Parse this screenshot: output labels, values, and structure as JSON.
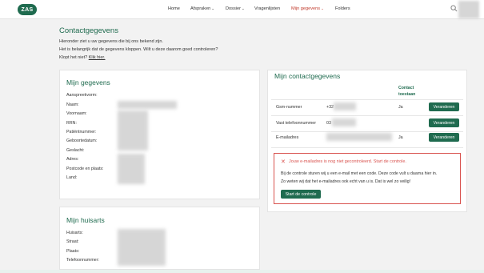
{
  "header": {
    "logo_text": "ZAS",
    "nav": [
      {
        "label": "Home",
        "dropdown": false,
        "active": false
      },
      {
        "label": "Afspraken",
        "dropdown": true,
        "active": false
      },
      {
        "label": "Dossier",
        "dropdown": true,
        "active": false
      },
      {
        "label": "Vragenlijsten",
        "dropdown": false,
        "active": false
      },
      {
        "label": "Mijn gegevens",
        "dropdown": true,
        "active": true
      },
      {
        "label": "Folders",
        "dropdown": false,
        "active": false
      }
    ],
    "chevron": "⌄",
    "icons": {
      "search": "search-icon",
      "avatar": "avatar"
    }
  },
  "page": {
    "title": "Contactgegevens",
    "intro_lines": [
      "Hieronder ziet u uw gegevens die bij ons bekend zijn.",
      "Het is belangrijk dat de gegevens kloppen. Wilt u deze daarom goed controleren?"
    ],
    "intro_question": "Klopt het niet?",
    "intro_link": "Klik hier."
  },
  "mijn_gegevens": {
    "title": "Mijn gegevens",
    "labels": [
      "Aanspreekvorm:",
      "Naam:",
      "Voornaam:",
      "RRN:",
      "Patiëntnummer:",
      "Geboortedatum:",
      "Geslacht:",
      "Adres:",
      "Postcode en plaats:",
      "Land:"
    ]
  },
  "mijn_huisarts": {
    "title": "Mijn huisarts",
    "labels": [
      "Huisarts:",
      "Straat:",
      "Plaats:",
      "Telefoonnummer:"
    ]
  },
  "contact": {
    "title": "Mijn contactgegevens",
    "column_header": "Contact toestaan",
    "rows": [
      {
        "label": "Gsm-nummer",
        "value_partial": "+32",
        "allowed": "Ja",
        "button": "Veranderen"
      },
      {
        "label": "Vast telefoonnummer",
        "value_partial": "03",
        "allowed": "",
        "button": "Veranderen"
      },
      {
        "label": "E-mailadres",
        "value_partial": "",
        "allowed": "Ja",
        "button": "Veranderen"
      }
    ]
  },
  "alert": {
    "icon": "close-icon",
    "title": "Jouw e-mailadres is nog niet gecontroleerd. Start de controle.",
    "lines": [
      "Bij de controle sturen wij u een e-mail met een code. Deze code vult u daarna hier in.",
      "Zo weten wij dat het e-mailadres ook echt van u is. Dat is wel zo veilig!"
    ],
    "button": "Start de controle"
  },
  "colors": {
    "accent": "#1f6b4f",
    "alert": "#d9534f",
    "active_nav": "#c0392b"
  }
}
